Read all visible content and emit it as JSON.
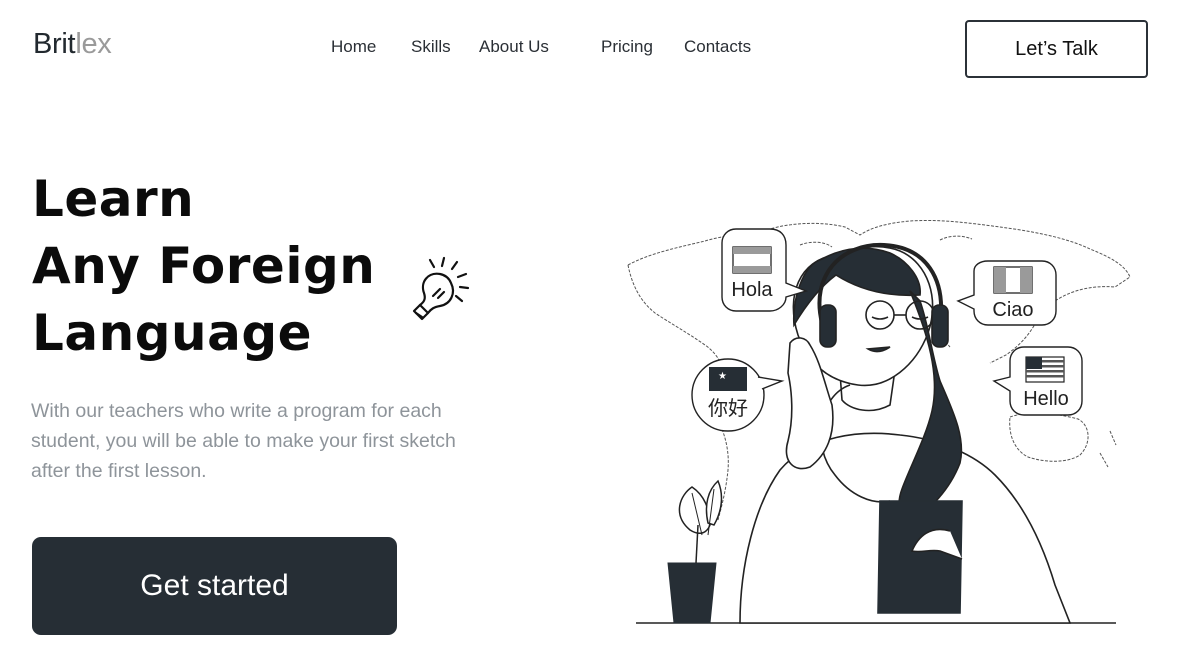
{
  "brand": {
    "part1": "Brit",
    "part2": "lex"
  },
  "nav": {
    "home": "Home",
    "skills": "Skills",
    "about": "About Us",
    "pricing": "Pricing",
    "contacts": "Contacts"
  },
  "header": {
    "cta_label": "Let’s Talk"
  },
  "hero": {
    "title_line1": "Learn",
    "title_line2": "Any Foreign",
    "title_line3": "Language",
    "description": "With our teachers who write a program for each student, you will be able to make your first sketch after the first lesson.",
    "cta_label": "Get started"
  },
  "illustration": {
    "greetings": {
      "spanish": "Hola",
      "italian": "Ciao",
      "chinese": "你好",
      "english": "Hello"
    }
  },
  "colors": {
    "dark": "#262e35",
    "muted_text": "#8e949a",
    "logo_gray": "#9a9a9a"
  }
}
